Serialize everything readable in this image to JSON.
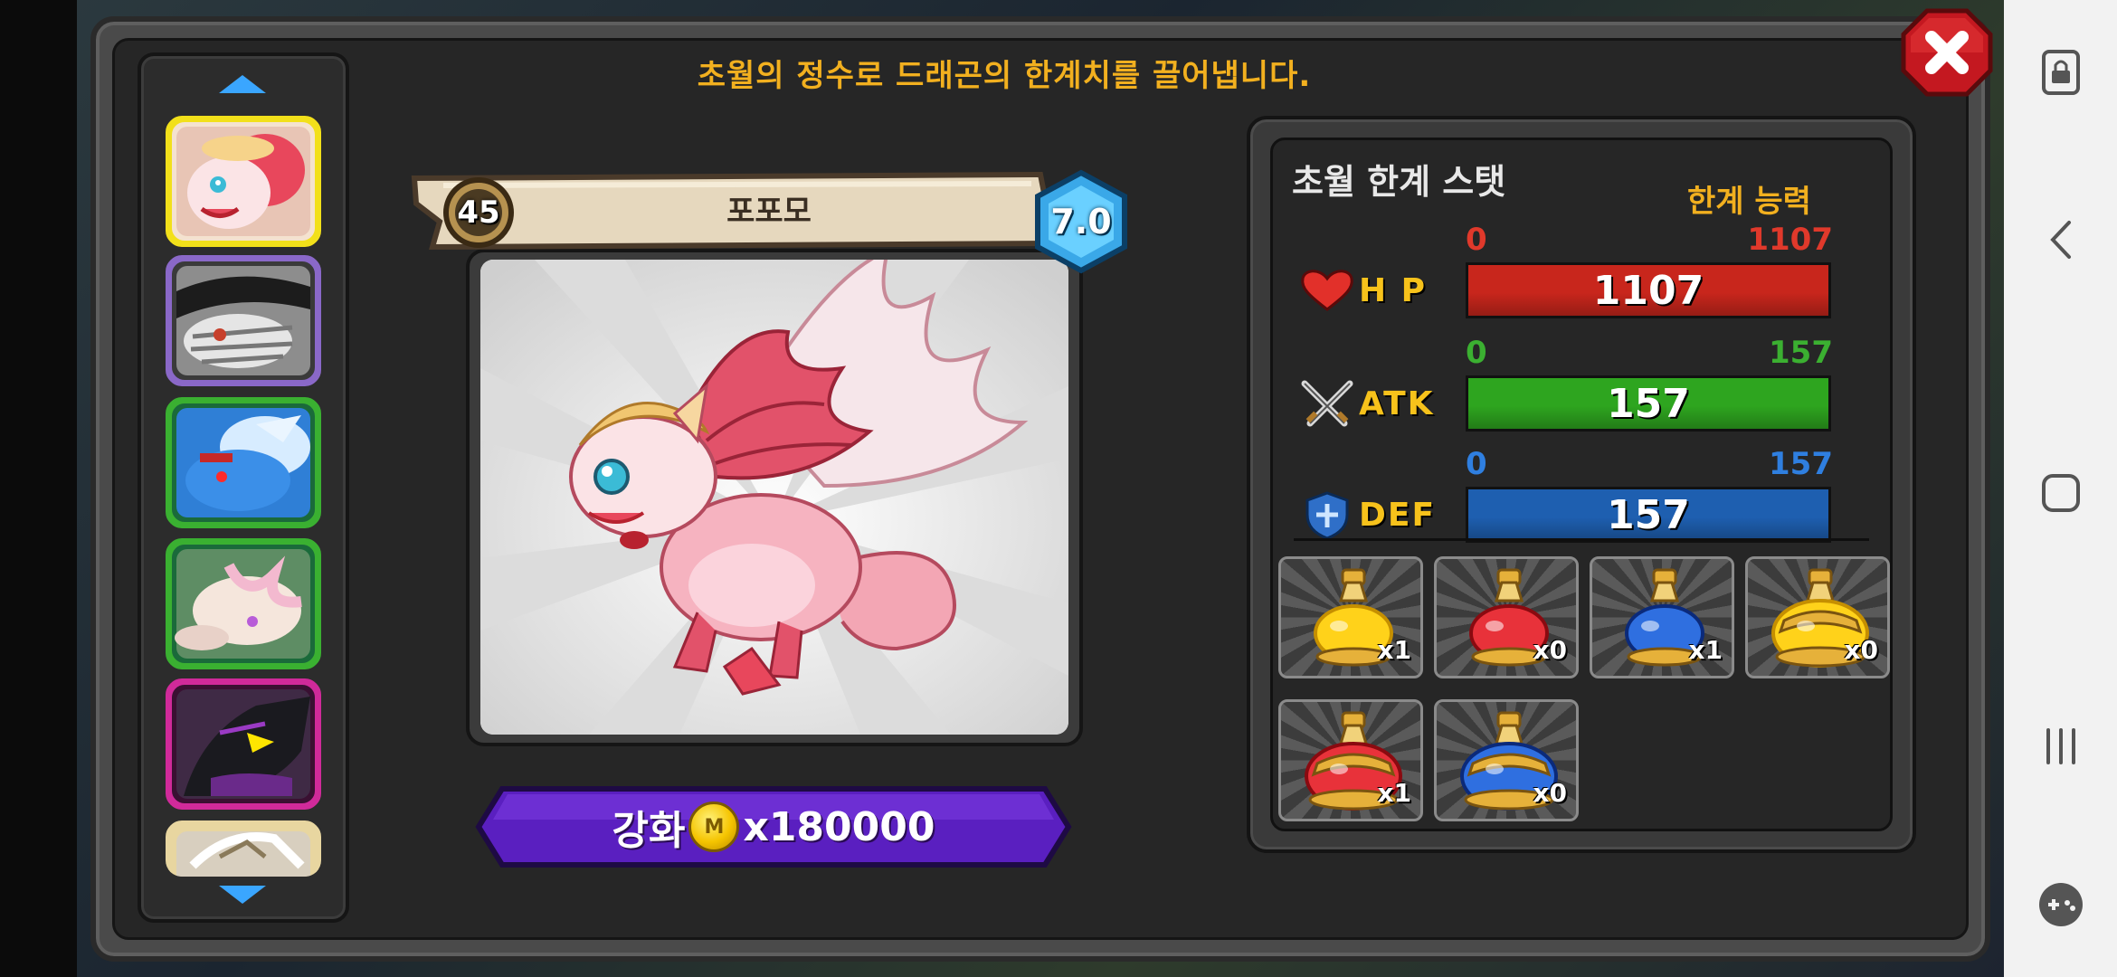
{
  "headline": "초월의 정수로 드래곤의 한계치를 끌어냅니다.",
  "dragon": {
    "name": "포포모",
    "level": "45",
    "grade": "7.0"
  },
  "upgrade": {
    "label": "강화",
    "cost": "x180000",
    "coin_mark": "M"
  },
  "stats_panel": {
    "title": "초월 한계 스탯",
    "limit_label": "한계 능력",
    "stats": [
      {
        "name": "H P",
        "min": "0",
        "max": "1107",
        "value": "1107",
        "fill": 1.0,
        "color": "#c8261c",
        "label_color": "#e0392b",
        "icon": "heart-icon"
      },
      {
        "name": "ATK",
        "min": "0",
        "max": "157",
        "value": "157",
        "fill": 1.0,
        "color": "#2ea51f",
        "label_color": "#3bb031",
        "icon": "crossed-swords-icon"
      },
      {
        "name": "DEF",
        "min": "0",
        "max": "157",
        "value": "157",
        "fill": 1.0,
        "color": "#1e5fb0",
        "label_color": "#2f7fe0",
        "icon": "shield-icon"
      }
    ]
  },
  "potions": [
    {
      "color": "yellow",
      "count": "x1"
    },
    {
      "color": "red",
      "count": "x0"
    },
    {
      "color": "blue",
      "count": "x1"
    },
    {
      "color": "large-yellow",
      "count": "x0"
    },
    {
      "color": "large-red",
      "count": "x1"
    },
    {
      "color": "large-blue",
      "count": "x0"
    }
  ],
  "roster": [
    {
      "name": "pink-dragon",
      "frame": "#f2e01a",
      "selected": true
    },
    {
      "name": "mummy-dragon",
      "frame": "#8a68c8",
      "selected": false
    },
    {
      "name": "blue-dragon",
      "frame": "#3ab031",
      "selected": false
    },
    {
      "name": "white-pink-dragon",
      "frame": "#3ab031",
      "selected": false
    },
    {
      "name": "dark-purple-dragon",
      "frame": "#d02a9a",
      "selected": false
    },
    {
      "name": "partial-dragon",
      "frame": "#e8d6a0",
      "selected": false
    }
  ],
  "colors": {
    "headline": "#f2b01f",
    "panel": "#262626",
    "upgrade_button": "#5a1fc0"
  }
}
